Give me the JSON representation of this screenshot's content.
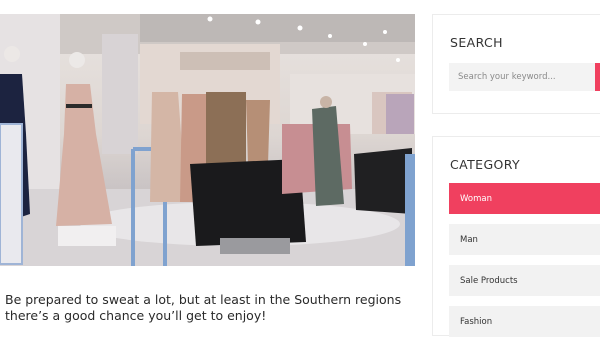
{
  "post": {
    "excerpt": "Be prepared to sweat a lot, but at least in the Southern regions there’s a good chance you’ll get to enjoy!"
  },
  "sidebar": {
    "search": {
      "title": "SEARCH",
      "placeholder": "Search your keyword...",
      "accent_color": "#f0405f"
    },
    "category": {
      "title": "CATEGORY",
      "items": [
        {
          "label": "Woman",
          "active": true
        },
        {
          "label": "Man",
          "active": false
        },
        {
          "label": "Sale Products",
          "active": false
        },
        {
          "label": "Fashion",
          "active": false
        }
      ]
    }
  }
}
